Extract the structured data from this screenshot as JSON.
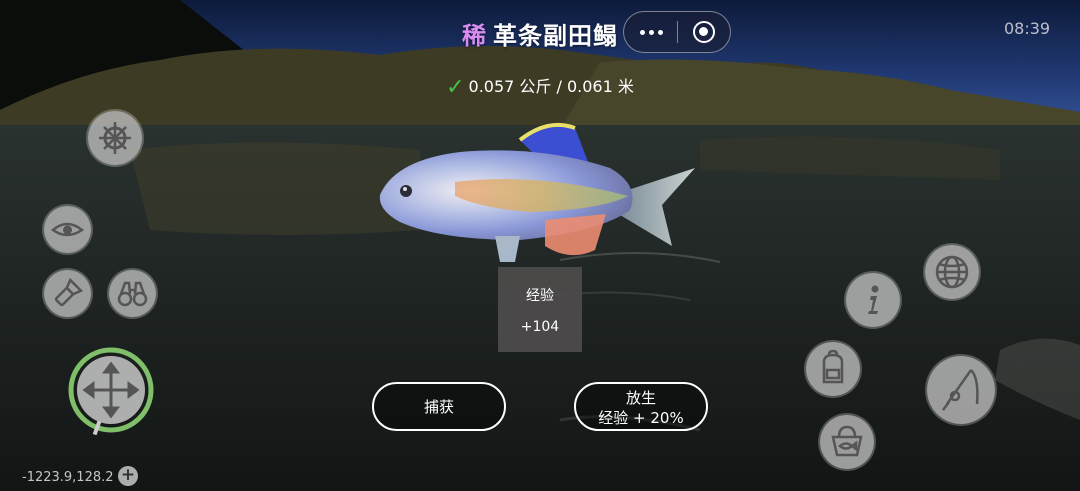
{
  "header": {
    "rarity_label": "稀",
    "fish_name": "革条副田鳎",
    "clock": "08:39",
    "capsule_more_icon": "more-dots-icon",
    "capsule_close_icon": "target-close-icon"
  },
  "catch_info": {
    "check_icon": "✓",
    "measure_text": "0.057 公斤 / 0.061 米"
  },
  "experience": {
    "label": "经验",
    "value": "+104"
  },
  "actions": {
    "catch_label": "捕获",
    "release_label": "放生",
    "release_bonus": "经验 + 20%"
  },
  "hud": {
    "coordinates": "-1223.9,128.2",
    "plus_label": "+",
    "left_icons": [
      "ship-wheel-icon",
      "eye-icon",
      "flashlight-icon",
      "binoculars-icon",
      "move-joystick-icon"
    ],
    "right_icons": [
      "globe-icon",
      "info-icon",
      "backpack-icon",
      "fish-basket-icon",
      "fishing-rod-icon"
    ]
  },
  "colors": {
    "rarity": "#d88cf0",
    "check": "#47c24a",
    "joystick_ring": "#7fbf6a"
  }
}
